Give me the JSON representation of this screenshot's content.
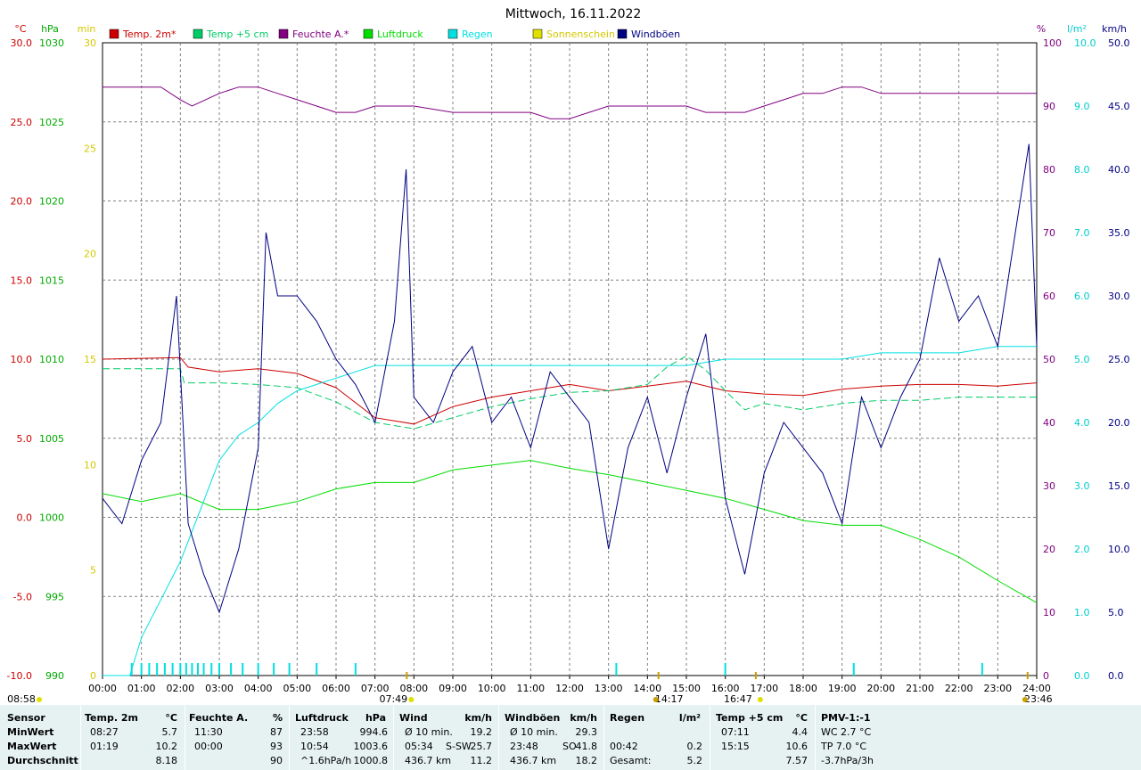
{
  "title": "Mittwoch, 16.11.2022",
  "colors": {
    "temp2m": "#cc0000",
    "temp5cm": "#00cc66",
    "feuchte": "#800080",
    "luftdruck": "#00dd00",
    "regen": "#00e0e0",
    "sonne": "#e0e000",
    "wind": "#000080",
    "grid": "#808080"
  },
  "axes": {
    "temp": {
      "unit": "°C",
      "ticks": [
        "30.0",
        "25.0",
        "20.0",
        "15.0",
        "10.0",
        "5.0",
        "0.0",
        "-5.0",
        "-10.0"
      ],
      "range": [
        -10,
        30
      ]
    },
    "hpa": {
      "unit": "hPa",
      "ticks": [
        "1030",
        "1025",
        "1020",
        "1015",
        "1010",
        "1005",
        "1000",
        "995",
        "990"
      ],
      "range": [
        990,
        1030
      ]
    },
    "min": {
      "unit": "min",
      "ticks": [
        "30",
        "25",
        "20",
        "15",
        "10",
        "5",
        "0"
      ],
      "range": [
        0,
        30
      ]
    },
    "pct": {
      "unit": "%",
      "ticks": [
        "100",
        "90",
        "80",
        "70",
        "60",
        "50",
        "40",
        "30",
        "20",
        "10",
        "0"
      ],
      "range": [
        0,
        100
      ]
    },
    "lm2": {
      "unit": "l/m²",
      "ticks": [
        "10.0",
        "9.0",
        "8.0",
        "7.0",
        "6.0",
        "5.0",
        "4.0",
        "3.0",
        "2.0",
        "1.0",
        "0.0"
      ],
      "range": [
        0,
        10
      ]
    },
    "kmh": {
      "unit": "km/h",
      "ticks": [
        "50.0",
        "45.0",
        "40.0",
        "35.0",
        "30.0",
        "25.0",
        "20.0",
        "15.0",
        "10.0",
        "5.0",
        "0.0"
      ],
      "range": [
        0,
        50
      ]
    },
    "x": {
      "ticks": [
        "00:00",
        "01:00",
        "02:00",
        "03:00",
        "04:00",
        "05:00",
        "06:00",
        "07:00",
        "08:00",
        "09:00",
        "10:00",
        "11:00",
        "12:00",
        "13:00",
        "14:00",
        "15:00",
        "16:00",
        "17:00",
        "18:00",
        "19:00",
        "20:00",
        "21:00",
        "22:00",
        "23:00",
        "24:00"
      ]
    }
  },
  "legend": [
    {
      "label": "Temp. 2m*",
      "color": "#cc0000"
    },
    {
      "label": "Temp +5 cm",
      "color": "#00cc66"
    },
    {
      "label": "Feuchte A.*",
      "color": "#800080"
    },
    {
      "label": "Luftdruck",
      "color": "#00dd00"
    },
    {
      "label": "Regen",
      "color": "#00e0e0"
    },
    {
      "label": "Sonnenschein",
      "color": "#e0e000"
    },
    {
      "label": "Windböen",
      "color": "#000080"
    }
  ],
  "sun_markers": {
    "sunrise_prev": "08:58",
    "sunrise": "07:49",
    "moon_set": "14:17",
    "sunset": "16:47",
    "moon_rise": "23:46"
  },
  "chart_data": {
    "type": "line",
    "title": "Mittwoch, 16.11.2022",
    "x_unit": "h",
    "series": [
      {
        "name": "Temp. 2m*",
        "axis": "°C",
        "x": [
          0,
          2,
          2.2,
          3,
          4,
          5,
          6,
          7,
          8,
          9,
          10,
          11,
          12,
          13,
          14,
          15,
          16,
          17,
          18,
          19,
          20,
          21,
          22,
          23,
          24
        ],
        "values": [
          10.0,
          10.1,
          9.5,
          9.2,
          9.4,
          9.1,
          8.2,
          6.3,
          5.9,
          7.0,
          7.6,
          8.0,
          8.4,
          8.0,
          8.3,
          8.6,
          8.0,
          7.8,
          7.7,
          8.1,
          8.3,
          8.4,
          8.4,
          8.3,
          8.5
        ]
      },
      {
        "name": "Temp +5 cm",
        "axis": "°C",
        "x": [
          0,
          2,
          2.1,
          3,
          4,
          5,
          6,
          7,
          8,
          9,
          10,
          11,
          12,
          13,
          14,
          14.5,
          15,
          15.5,
          16,
          16.5,
          17,
          18,
          19,
          20,
          21,
          22,
          23,
          24
        ],
        "values": [
          9.4,
          9.4,
          8.5,
          8.5,
          8.4,
          8.2,
          7.3,
          6.0,
          5.6,
          6.3,
          7.0,
          7.5,
          7.9,
          8.0,
          8.4,
          9.5,
          10.2,
          9.3,
          8.0,
          6.8,
          7.2,
          6.8,
          7.2,
          7.4,
          7.4,
          7.6,
          7.6,
          7.6
        ]
      },
      {
        "name": "Feuchte A.*",
        "axis": "%",
        "x": [
          0,
          1.5,
          2,
          2.3,
          3,
          3.5,
          4,
          4.5,
          5,
          5.5,
          6,
          6.5,
          7,
          7.5,
          8,
          9,
          10,
          11,
          11.5,
          12,
          12.5,
          13,
          14,
          15,
          15.5,
          16,
          16.5,
          17,
          17.5,
          18,
          18.5,
          19,
          19.5,
          20,
          21,
          22,
          23,
          24
        ],
        "values": [
          93,
          93,
          91,
          90,
          92,
          93,
          93,
          92,
          91,
          90,
          89,
          89,
          90,
          90,
          90,
          89,
          89,
          89,
          88,
          88,
          89,
          90,
          90,
          90,
          89,
          89,
          89,
          90,
          91,
          92,
          92,
          93,
          93,
          92,
          92,
          92,
          92,
          92
        ]
      },
      {
        "name": "Luftdruck",
        "axis": "hPa",
        "x": [
          0,
          1,
          2,
          3,
          4,
          5,
          6,
          7,
          8,
          9,
          10,
          11,
          12,
          13,
          14,
          15,
          16,
          17,
          18,
          19,
          20,
          21,
          22,
          23,
          24
        ],
        "values": [
          1001.5,
          1001.0,
          1001.5,
          1000.5,
          1000.5,
          1001.0,
          1001.8,
          1002.2,
          1002.2,
          1003.0,
          1003.3,
          1003.6,
          1003.1,
          1002.7,
          1002.2,
          1001.7,
          1001.2,
          1000.5,
          999.8,
          999.5,
          999.5,
          998.6,
          997.5,
          996.0,
          994.6
        ]
      },
      {
        "name": "Regen",
        "axis": "l/m²",
        "x": [
          0,
          0.7,
          1,
          1.5,
          2,
          2.5,
          3,
          3.5,
          4,
          4.5,
          5,
          5.5,
          6,
          6.5,
          7,
          7.5,
          8,
          9,
          10,
          11,
          12,
          13,
          14,
          15,
          16,
          17,
          18,
          19,
          20,
          21,
          22,
          23,
          24
        ],
        "values": [
          0,
          0,
          0.6,
          1.2,
          1.8,
          2.6,
          3.4,
          3.8,
          4.0,
          4.3,
          4.5,
          4.6,
          4.7,
          4.8,
          4.9,
          4.9,
          4.9,
          4.9,
          4.9,
          4.9,
          4.9,
          4.9,
          4.9,
          4.9,
          5.0,
          5.0,
          5.0,
          5.0,
          5.1,
          5.1,
          5.1,
          5.2,
          5.2
        ]
      },
      {
        "name": "Windböen",
        "axis": "km/h",
        "x": [
          0,
          0.5,
          1,
          1.5,
          1.9,
          2.2,
          2.6,
          3,
          3.5,
          4,
          4.2,
          4.5,
          5,
          5.5,
          6,
          6.5,
          7,
          7.5,
          7.8,
          8,
          8.5,
          9,
          9.5,
          10,
          10.5,
          11,
          11.5,
          12,
          12.5,
          13,
          13.5,
          14,
          14.5,
          15,
          15.5,
          16,
          16.5,
          17,
          17.5,
          18,
          18.5,
          19,
          19.5,
          20,
          20.5,
          21,
          21.5,
          22,
          22.5,
          23,
          23.5,
          23.8,
          24
        ],
        "values": [
          14,
          12,
          17,
          20,
          30,
          12,
          8,
          5,
          10,
          18,
          35,
          30,
          30,
          28,
          25,
          23,
          20,
          28,
          40,
          22,
          20,
          24,
          26,
          20,
          22,
          18,
          24,
          22,
          20,
          10,
          18,
          22,
          16,
          22,
          27,
          14,
          8,
          16,
          20,
          18,
          16,
          12,
          22,
          18,
          22,
          25,
          33,
          28,
          30,
          26,
          36,
          42,
          26
        ]
      }
    ]
  },
  "stats": {
    "headers": [
      "Sensor",
      "Temp. 2m",
      "°C",
      "Feuchte A.",
      "%",
      "Luftdruck",
      "hPa",
      "Wind",
      "km/h",
      "Windböen",
      "km/h",
      "Regen",
      "l/m²",
      "Temp +5 cm",
      "°C",
      "PMV-1:-1"
    ],
    "rows": [
      {
        "label": "MinWert",
        "temp_time": "08:27",
        "temp_val": "5.7",
        "hum_time": "11:30",
        "hum_val": "87",
        "press_time": "23:58",
        "press_val": "994.6",
        "wind_label": "Ø 10 min.",
        "wind_val": "19.2",
        "gust_label": "Ø 10 min.",
        "gust_val": "29.3",
        "rain_time": "",
        "rain_val": "",
        "t5_time": "07:11",
        "t5_val": "4.4",
        "pmv": "WC 2.7 °C"
      },
      {
        "label": "MaxWert",
        "temp_time": "01:19",
        "temp_val": "10.2",
        "hum_time": "00:00",
        "hum_val": "93",
        "press_time": "10:54",
        "press_val": "1003.6",
        "wind_label": "05:34",
        "wind_dir": "S-SW",
        "wind_val": "25.7",
        "gust_label": "23:48",
        "gust_dir": "SO",
        "gust_val": "41.8",
        "rain_time": "00:42",
        "rain_val": "0.2",
        "t5_time": "15:15",
        "t5_val": "10.6",
        "pmv": "TP 7.0 °C"
      },
      {
        "label": "Durchschnitt",
        "temp_time": "",
        "temp_val": "8.18",
        "hum_time": "",
        "hum_val": "90",
        "press_time": "^1.6hPa/h",
        "press_val": "1000.8",
        "wind_label": "436.7 km",
        "wind_val": "11.2",
        "gust_label": "436.7 km",
        "gust_val": "18.2",
        "rain_time": "Gesamt:",
        "rain_val": "5.2",
        "t5_time": "",
        "t5_val": "7.57",
        "pmv": "-3.7hPa/3h"
      }
    ]
  }
}
